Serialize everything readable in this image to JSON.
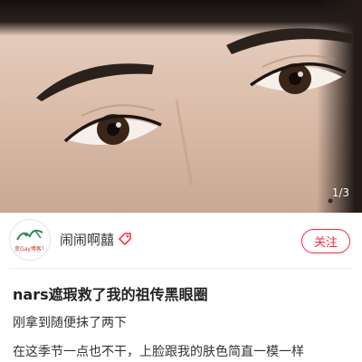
{
  "photo": {
    "page_indicator": "1/3"
  },
  "author": {
    "avatar_text": "变Gay博客！",
    "name": "闹闹啊囍",
    "follow_label": "关注"
  },
  "post": {
    "title": "nars遮瑕救了我的祖传黑眼圈",
    "lines": [
      "刚拿到随便抹了两下",
      "在这季节一点也不干，上脸跟我的肤色简直一模一样"
    ]
  },
  "colors": {
    "accent": "#ff2442",
    "text": "#222222"
  }
}
